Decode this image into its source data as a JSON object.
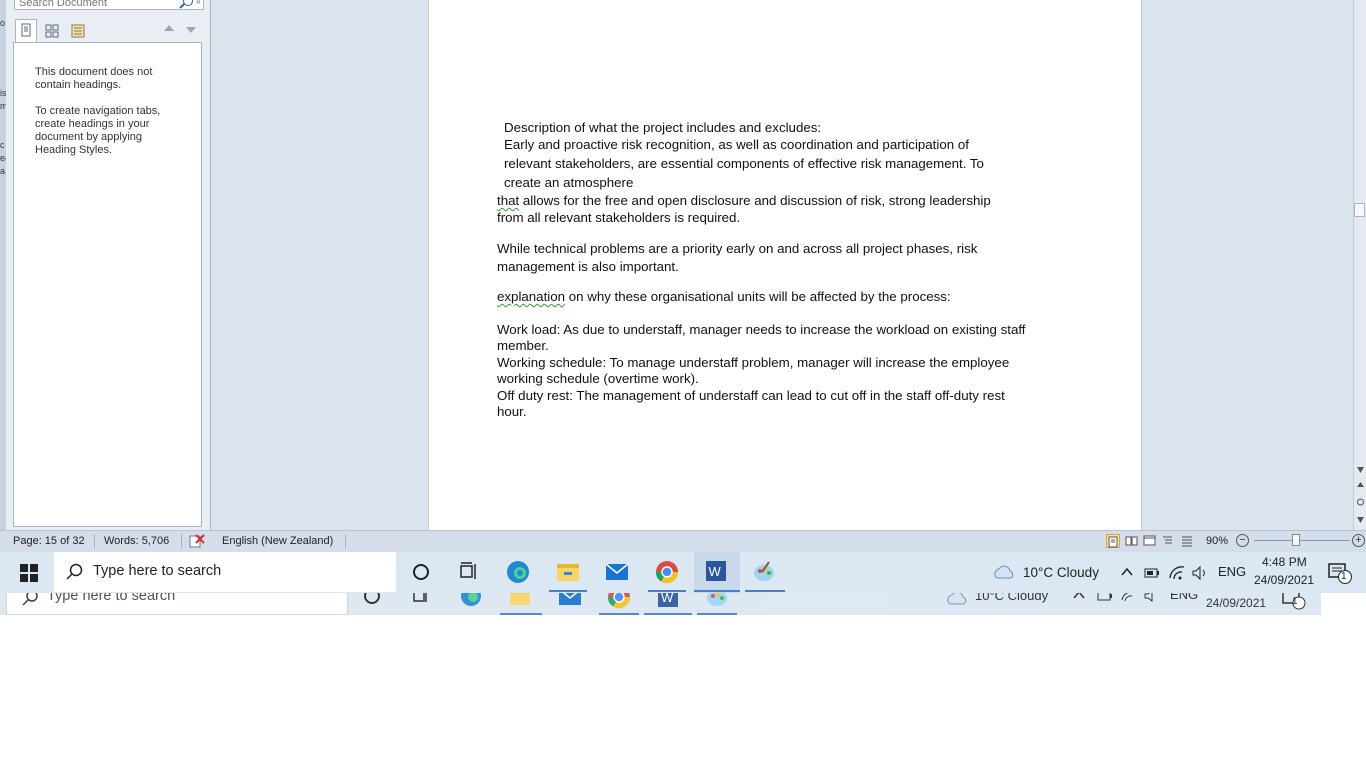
{
  "nav_pane": {
    "search_placeholder": "Search Document",
    "search_clear": "×",
    "message_1": "This document does not contain headings.",
    "message_2": "To create navigation tabs, create headings in your document by applying Heading Styles."
  },
  "left_strip_chars": [
    "o",
    "i",
    "is",
    "m",
    "c",
    "ea",
    "d",
    "a"
  ],
  "document": {
    "lines": [
      "Description of what the project includes and excludes:",
      "Early and proactive risk recognition, as well as coordination and participation of",
      "relevant stakeholders, are essential components of effective risk management.  To",
      "create an atmosphere",
      "allows  for the free and  open disclosure and discussion of risk, strong leadership",
      "from all relevant stakeholders is required.",
      "While technical problems are a priority early on and across all project phases, risk",
      "management  is also important.",
      "on why these organisational  units will be affected by the process:",
      "Work load:  As due to understaff, manager needs to increase  the workload on existing staff",
      "member.",
      "Working schedule: To manage  understaff problem, manager  will increase the employee",
      "working schedule (overtime work).",
      "Off duty rest: The management  of understaff can lead to cut off in the staff off-duty rest",
      "hour."
    ],
    "flagged_word_1": "that",
    "flagged_word_2": "explanation"
  },
  "status_bar": {
    "page": "Page: 15 of 32",
    "words": "Words: 5,706",
    "language": "English (New Zealand)",
    "zoom": "90%",
    "zoom_minus": "−",
    "zoom_plus": "+",
    "zoom_level_percent": 90
  },
  "taskbar": {
    "search_placeholder": "Type here to search",
    "weather": "10°C  Cloudy",
    "language": "ENG",
    "time": "4:48 PM",
    "date": "24/09/2021",
    "notification_count": "1"
  },
  "taskbar_ghost": {
    "search_placeholder": "Type here to search",
    "weather": "10°C  Cloudy",
    "language": "ENG",
    "date": "24/09/2021",
    "notification_count": "1"
  },
  "colors": {
    "workspace": "#dbe3ed",
    "accent": "#2b579a",
    "taskbar": "#dbe7f3",
    "spell_squiggle": "#3c9a3c"
  },
  "icons": [
    "search-icon",
    "page-thumbnail-icon",
    "grid-thumbnail-icon",
    "results-icon",
    "spelling-check-icon",
    "windows-start-icon",
    "cortana-icon",
    "task-view-icon",
    "edge-icon",
    "file-explorer-icon",
    "mail-icon",
    "chrome-icon",
    "word-icon",
    "paint-icon",
    "cloud-icon",
    "chevron-up-icon",
    "battery-icon",
    "wifi-icon",
    "speaker-icon",
    "notification-icon"
  ]
}
